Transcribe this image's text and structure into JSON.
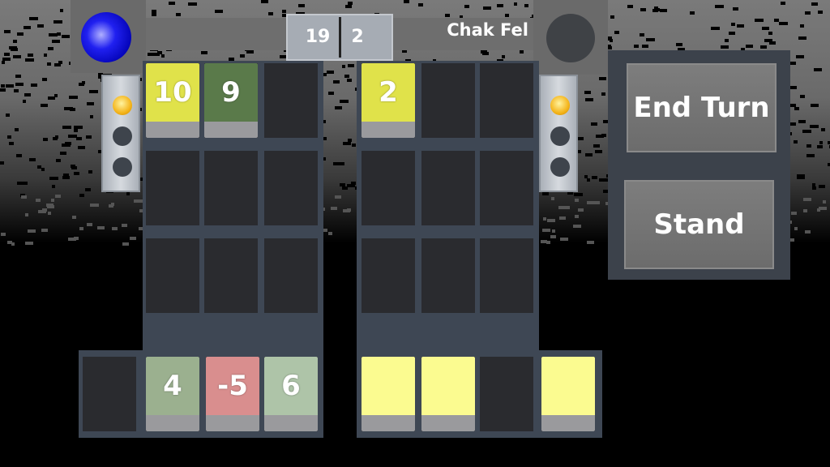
{
  "player": {
    "avatar_color": "#1010e0",
    "score": "19",
    "lights_on": 1
  },
  "opponent": {
    "name": "Chak Fel",
    "score": "2",
    "lights_on": 1
  },
  "player_board": [
    {
      "value": "10",
      "color": "#e0e24a"
    },
    {
      "value": "9",
      "color": "#5a7a4a"
    },
    null,
    null,
    null,
    null,
    null,
    null,
    null
  ],
  "opponent_board": [
    {
      "value": "2",
      "color": "#e0e24a"
    },
    null,
    null,
    null,
    null,
    null,
    null,
    null,
    null
  ],
  "player_hand": [
    null,
    {
      "value": "4",
      "color": "#9bb08f"
    },
    {
      "value": "-5",
      "color": "#d98e8e"
    },
    {
      "value": "6",
      "color": "#aec4a8"
    }
  ],
  "opponent_hand": [
    {
      "value": "",
      "color": "#fbfb90"
    },
    {
      "value": "",
      "color": "#fbfb90"
    },
    null,
    {
      "value": "",
      "color": "#fbfb90"
    }
  ],
  "buttons": {
    "end_turn": "End Turn",
    "stand": "Stand"
  }
}
